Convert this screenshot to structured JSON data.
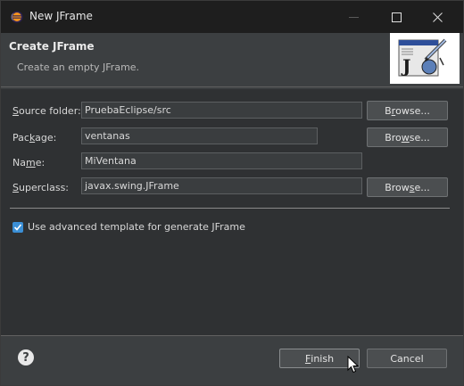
{
  "window": {
    "title": "New JFrame"
  },
  "header": {
    "title": "Create JFrame",
    "description": "Create an empty JFrame."
  },
  "form": {
    "source_folder": {
      "label_u": "S",
      "label_rest": "ource folder:",
      "value": "PruebaEclipse/src",
      "browse_u": "r",
      "browse_pre": "B",
      "browse_post": "owse..."
    },
    "package": {
      "label_pre": "Pac",
      "label_u": "k",
      "label_rest": "age:",
      "value": "ventanas",
      "browse_pre": "Bro",
      "browse_u": "w",
      "browse_post": "se..."
    },
    "name": {
      "label_pre": "Na",
      "label_u": "m",
      "label_rest": "e:",
      "value": "MiVentana"
    },
    "superclass": {
      "label_u": "S",
      "label_rest": "uperclass:",
      "value": "javax.swing.JFrame",
      "browse_pre": "Brow",
      "browse_u": "s",
      "browse_post": "e..."
    },
    "advanced_template": {
      "label": "Use advanced template for generate JFrame",
      "checked": true
    }
  },
  "footer": {
    "help_label": "?",
    "finish_u": "F",
    "finish_rest": "inish",
    "cancel_label": "Cancel"
  },
  "colors": {
    "accent": "#3b8fd6",
    "titlebar": "#1e1e1e",
    "dialog_bg": "#3c3f41",
    "form_bg": "#2f3133"
  }
}
